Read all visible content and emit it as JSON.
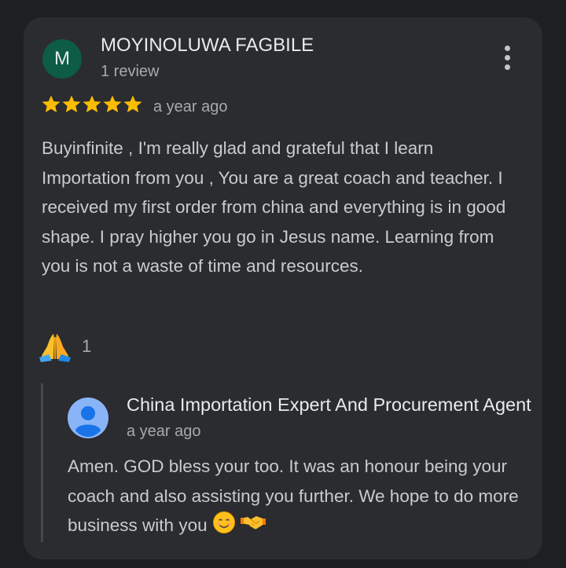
{
  "review": {
    "avatar_letter": "M",
    "author_name": "MOYINOLUWA FAGBILE",
    "author_meta": "1 review",
    "rating": 5,
    "rating_max": 5,
    "date": "a year ago",
    "text": "Buyinfinite , I'm really glad and grateful that I learn Importation from you , You are a great coach and teacher. I received my first order from china and everything is in good shape. I pray higher you go in Jesus name. Learning from you is not a waste of time and resources.",
    "reaction_icon": "folded-hands-icon",
    "reaction_count": "1"
  },
  "reply": {
    "owner_name": "China Importation Expert And Procurement Agent",
    "date": "a year ago",
    "text": "Amen. GOD bless your too. It was an honour being your coach and also assisting you further. We hope to do more business with you",
    "emojis": [
      "smiling-face-icon",
      "handshake-icon"
    ]
  },
  "colors": {
    "background": "#1e1f21",
    "card": "#2b2c2f",
    "avatar_bg": "#0d5c46",
    "star": "#fbbc04",
    "owner_avatar": "#8ab4f8"
  }
}
